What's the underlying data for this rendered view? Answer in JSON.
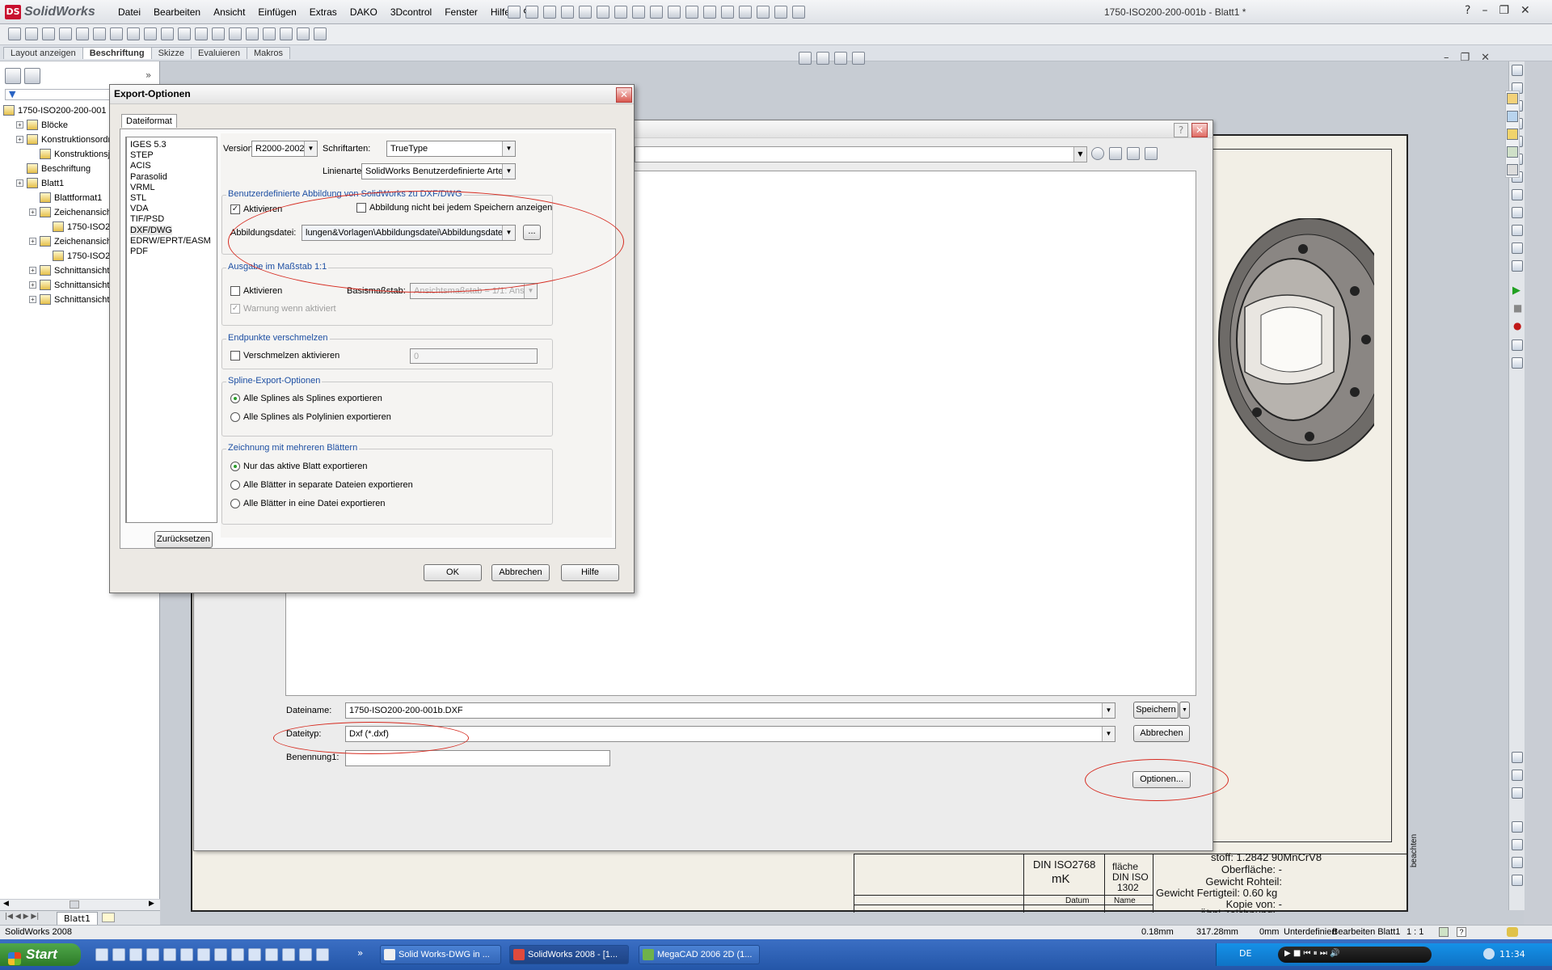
{
  "app": {
    "name": "SolidWorks",
    "document_title": "1750-ISO200-200-001b - Blatt1 *",
    "menu": [
      "Datei",
      "Bearbeiten",
      "Ansicht",
      "Einfügen",
      "Extras",
      "DAKO",
      "3Dcontrol",
      "Fenster",
      "Hilfe"
    ]
  },
  "command_tabs": [
    "Layout anzeigen",
    "Beschriftung",
    "Skizze",
    "Evaluieren",
    "Makros"
  ],
  "active_command_tab": "Beschriftung",
  "feature_tree": {
    "items": [
      {
        "label": "1750-ISO200-200-001",
        "level": 0,
        "icon": "drawing-icon"
      },
      {
        "label": "Blöcke",
        "level": 1,
        "icon": "blocks-icon"
      },
      {
        "label": "Konstruktionsordn",
        "level": 1,
        "icon": "design-folder-icon"
      },
      {
        "label": "Konstruktionsj",
        "level": 2,
        "icon": "design-journal-icon"
      },
      {
        "label": "Beschriftung",
        "level": 1,
        "icon": "annotation-icon"
      },
      {
        "label": "Blatt1",
        "level": 1,
        "icon": "sheet-icon"
      },
      {
        "label": "Blattformat1",
        "level": 2,
        "icon": "sheet-format-icon"
      },
      {
        "label": "Zeichenansich",
        "level": 2,
        "icon": "drawing-view-icon"
      },
      {
        "label": "1750-ISO2",
        "level": 3,
        "icon": "part-icon"
      },
      {
        "label": "Zeichenansich",
        "level": 2,
        "icon": "drawing-view-icon"
      },
      {
        "label": "1750-ISO2",
        "level": 3,
        "icon": "part-icon"
      },
      {
        "label": "Schnittansicht",
        "level": 2,
        "icon": "section-view-icon"
      },
      {
        "label": "Schnittansicht",
        "level": 2,
        "icon": "section-view-icon"
      },
      {
        "label": "Schnittansicht",
        "level": 2,
        "icon": "section-view-icon"
      }
    ],
    "sheet_tab": "Blatt1"
  },
  "save_dialog": {
    "filename_label": "Dateiname:",
    "filename_value": "1750-ISO200-200-001b.DXF",
    "filetype_label": "Dateityp:",
    "filetype_value": "Dxf (*.dxf)",
    "description_label": "Benennung1:",
    "description_value": "",
    "save_button": "Speichern",
    "cancel_button": "Abbrechen",
    "options_button": "Optionen..."
  },
  "export_dialog": {
    "title": "Export-Optionen",
    "tab": "Dateiformat",
    "formats": [
      "IGES 5.3",
      "STEP",
      "ACIS",
      "Parasolid",
      "VRML",
      "STL",
      "VDA",
      "TIF/PSD",
      "DXF/DWG",
      "EDRW/EPRT/EASM",
      "PDF"
    ],
    "selected_format": "DXF/DWG",
    "version_label": "Version:",
    "version_value": "R2000-2002",
    "fonts_label": "Schriftarten:",
    "fonts_value": "TrueType",
    "linetypes_label": "Linienarten:",
    "linetypes_value": "SolidWorks Benutzerdefinierte Arten",
    "custom_map": {
      "title": "Benutzerdefinierte Abbildung von SolidWorks zu DXF/DWG",
      "activate": "Aktivieren",
      "activate_checked": true,
      "dont_show": "Abbildung nicht bei jedem Speichern anzeigen",
      "dont_show_checked": false,
      "mapfile_label": "Abbildungsdatei:",
      "mapfile_value": "lungen&Vorlagen\\Abbildungsdatei\\Abbildungsdatei",
      "browse": "..."
    },
    "scale": {
      "title": "Ausgabe im Maßstab 1:1",
      "activate": "Aktivieren",
      "base_scale_label": "Basismaßstab:",
      "base_scale_value": "Ansichtsmaßstab = 1/1: Ans",
      "warn": "Warnung wenn aktiviert"
    },
    "endpoints": {
      "title": "Endpunkte verschmelzen",
      "merge": "Verschmelzen aktivieren",
      "merge_value": "0"
    },
    "spline": {
      "title": "Spline-Export-Optionen",
      "opt1": "Alle Splines als Splines exportieren",
      "opt2": "Alle Splines als Polylinien exportieren",
      "selected": 1
    },
    "multisheet": {
      "title": "Zeichnung mit mehreren Blättern",
      "opt1": "Nur das aktive Blatt exportieren",
      "opt2": "Alle Blätter in separate Dateien exportieren",
      "opt3": "Alle Blätter in eine Datei exportieren",
      "selected": 1
    },
    "reset_button": "Zurücksetzen",
    "ok_button": "OK",
    "cancel_button": "Abbrechen",
    "help_button": "Hilfe"
  },
  "title_block": {
    "std_line1": "DIN ISO2768",
    "std_line2": "mK",
    "surface_line1": "fläche",
    "surface_line2": "DIN ISO",
    "surface_line3": "1302",
    "material": "stoff: 1.2842 90MnCrV8",
    "surface": "Oberfläche: -",
    "raw_weight": "Gewicht Rohteil:",
    "finished_weight": "Gewicht Fertigteil: 0.60 kg",
    "copy_of": "Kopie von: -",
    "similar": "Ähnl.Zeichnung: -",
    "date_header": "Datum",
    "name_header": "Name",
    "side_note": "beachten"
  },
  "status_bar": {
    "product": "SolidWorks 2008",
    "x": "0.18mm",
    "y": "317.28mm",
    "z": "0mm",
    "state": "Unterdefiniert",
    "editing": "Bearbeiten Blatt1",
    "scale": "1 : 1"
  },
  "taskbar": {
    "start": "Start",
    "tasks": [
      "Solid Works-DWG in ...",
      "SolidWorks 2008 - [1...",
      "MegaCAD 2006 2D (1..."
    ],
    "active_task": 1,
    "lang": "DE",
    "clock": "11:34"
  }
}
